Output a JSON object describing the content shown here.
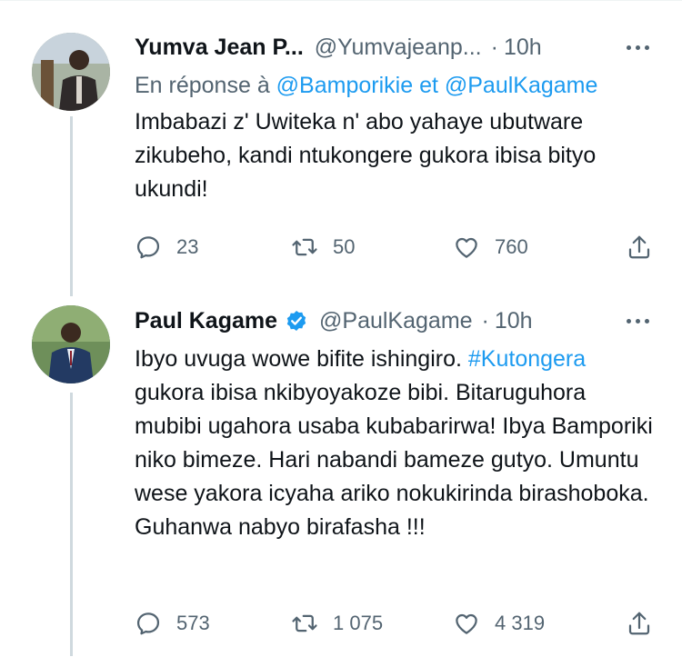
{
  "colors": {
    "accent": "#1d9bf0",
    "muted": "#536471",
    "text": "#0f1419",
    "thread": "#cfd9de"
  },
  "tweets": [
    {
      "name": "Yumva Jean P...",
      "handle": "@Yumvajeanp...",
      "dot": "·",
      "time": "10h",
      "reply_prefix": "En réponse à",
      "reply_to_1": "@Bamporikie",
      "reply_sep": "et",
      "reply_to_2": "@PaulKagame",
      "text": "Imbabazi z' Uwiteka n' abo yahaye ubutware zikubeho, kandi ntukongere gukora ibisa bityo ukundi!",
      "replies": "23",
      "retweets": "50",
      "likes": "760",
      "verified": false
    },
    {
      "name": "Paul Kagame",
      "handle": "@PaulKagame",
      "dot": "·",
      "time": "10h",
      "text_before_tag": "Ibyo uvuga wowe bifite ishingiro.",
      "hashtag": "#Kutongera",
      "text_after_tag": "gukora ibisa nkibyoyakoze bibi. Bitaruguhora mubibi ugahora usaba kubabarirwa! Ibya Bamporiki niko bimeze. Hari nabandi bameze gutyo. Umuntu wese yakora icyaha ariko nokukirinda birashoboka. Guhanwa nabyo birafasha !!!",
      "replies": "573",
      "retweets": "1 075",
      "likes": "4 319",
      "verified": true
    }
  ]
}
